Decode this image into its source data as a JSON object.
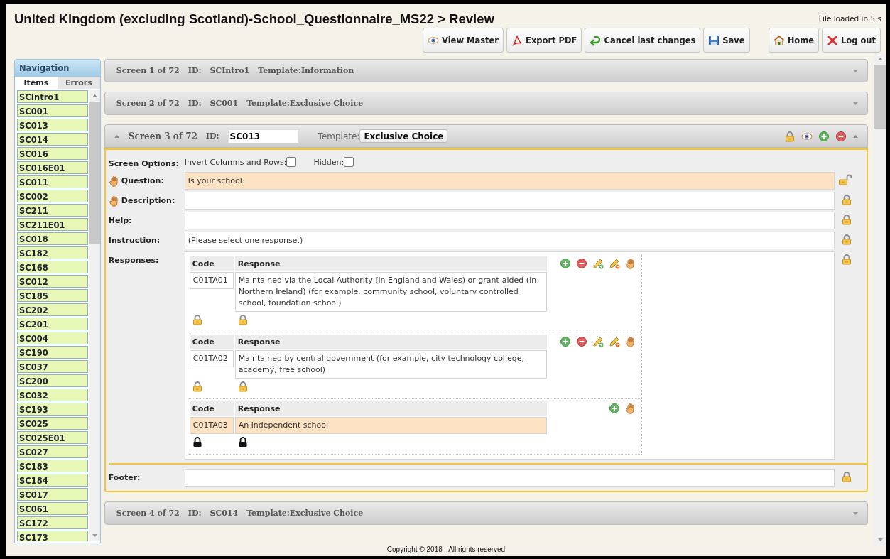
{
  "header": {
    "title": "United Kingdom (excluding Scotland)-School_Questionnaire_MS22 > Review",
    "load_status": "File loaded in 5 s"
  },
  "toolbar_groups": [
    {
      "buttons": [
        {
          "label": "View Master"
        },
        {
          "label": "Export PDF"
        },
        {
          "label": "Cancel last changes"
        },
        {
          "label": "Save"
        }
      ]
    },
    {
      "buttons": [
        {
          "label": "Home"
        },
        {
          "label": "Log out"
        }
      ]
    }
  ],
  "navigation": {
    "title": "Navigation",
    "tabs": [
      {
        "label": "Items",
        "selected": true
      },
      {
        "label": "Errors",
        "selected": false
      }
    ],
    "items": [
      "SCIntro1",
      "SC001",
      "SC013",
      "SC014",
      "SC016",
      "SC016E01",
      "SC011",
      "SC002",
      "SC211",
      "SC211E01",
      "SC018",
      "SC182",
      "SC168",
      "SC012",
      "SC185",
      "SC202",
      "SC201",
      "SC004",
      "SC190",
      "SC037",
      "SC200",
      "SC032",
      "SC193",
      "SC025",
      "SC025E01",
      "SC027",
      "SC183",
      "SC184",
      "SC017",
      "SC061",
      "SC172",
      "SC173"
    ]
  },
  "screens": [
    {
      "screen": "Screen 1 of 72",
      "id_label": "ID:",
      "id": "SCIntro1",
      "template": "Template:Information",
      "expanded": false
    },
    {
      "screen": "Screen 2 of 72",
      "id_label": "ID:",
      "id": "SC001",
      "template": "Template:Exclusive Choice",
      "expanded": false
    },
    {
      "screen": "Screen 3 of 72",
      "id_label": "ID:",
      "id": "SC013",
      "template_label": "Template:",
      "template": "Exclusive Choice",
      "expanded": true,
      "options": {
        "label": "Screen Options:",
        "items": [
          {
            "label": "Invert Columns and Rows:",
            "checked": false
          },
          {
            "label": "Hidden:",
            "checked": false
          }
        ]
      },
      "fields": [
        {
          "label": "Question:",
          "value": "Is your school:",
          "draggable": true,
          "highlighted": true,
          "locked": false
        },
        {
          "label": "Description:",
          "draggable": true,
          "highlighted": false,
          "locked": true
        },
        {
          "label": "Help:",
          "draggable": false,
          "highlighted": false,
          "locked": true
        },
        {
          "label": "Instruction:",
          "value": "(Please select one response.)",
          "draggable": false,
          "highlighted": false,
          "locked": true
        }
      ],
      "responses": {
        "label": "Responses:",
        "locked": true,
        "groups": [
          {
            "code_header": "Code",
            "response_header": "Response",
            "code": "C01TA01",
            "text": "Maintained via the Local Authority (in England and Wales) or grant-aided (in Northern Ireland) (for example, community school, voluntary controlled school, foundation school)",
            "highlighted": false,
            "master_locked": false,
            "removable": true
          },
          {
            "code_header": "Code",
            "response_header": "Response",
            "code": "C01TA02",
            "text": "Maintained by central government (for example, city technology college, academy, free school)",
            "highlighted": false,
            "master_locked": false,
            "removable": true
          },
          {
            "code_header": "Code",
            "response_header": "Response",
            "code": "C01TA03",
            "text": "An independent school",
            "highlighted": true,
            "master_locked": true,
            "removable": false
          }
        ]
      },
      "footer_field": {
        "label": "Footer:",
        "locked": true
      }
    },
    {
      "screen": "Screen 4 of 72",
      "id_label": "ID:",
      "id": "SC014",
      "template": "Template:Exclusive Choice",
      "expanded": false
    }
  ],
  "copyright": "Copyright © 2018 - All rights reserved"
}
